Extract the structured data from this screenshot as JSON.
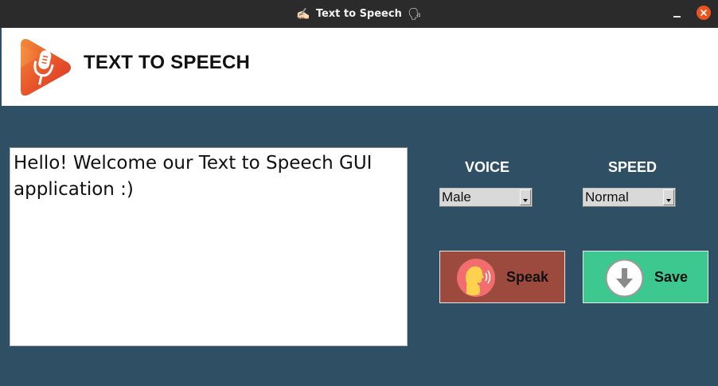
{
  "window": {
    "title": "Text to Speech",
    "title_emoji_left": "✍🏻",
    "title_emoji_right": "🗣"
  },
  "header": {
    "app_title": "TEXT TO SPEECH",
    "logo_icon": "microphone-play-logo"
  },
  "editor": {
    "text": "Hello! Welcome our Text to Speech GUI application :)"
  },
  "controls": {
    "voice_label": "VOICE",
    "voice_value": "Male",
    "speed_label": "SPEED",
    "speed_value": "Normal"
  },
  "buttons": {
    "speak_label": "Speak",
    "speak_icon": "speaking-head-icon",
    "save_label": "Save",
    "save_icon": "download-arrow-icon"
  },
  "colors": {
    "background": "#2f4f65",
    "speak_button": "#9c4a3e",
    "save_button": "#3cc88e",
    "close_button": "#e95420"
  }
}
